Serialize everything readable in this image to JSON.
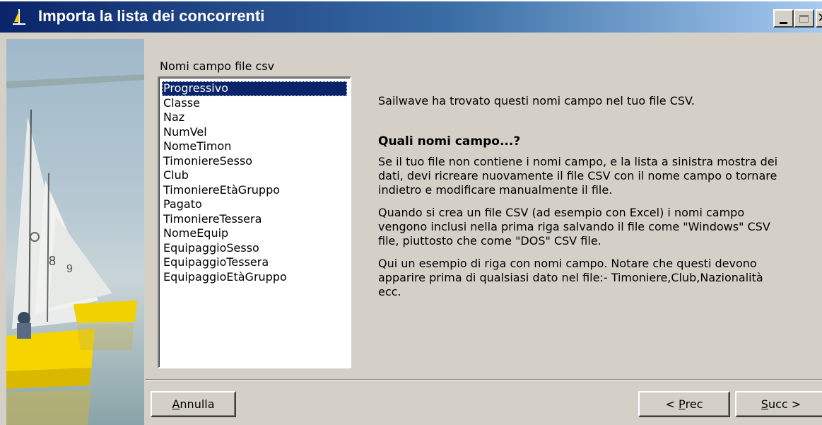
{
  "window": {
    "title": "Importa la lista dei concorrenti",
    "icon": "sailboat-app-icon"
  },
  "list": {
    "caption": "Nomi campo file csv",
    "items": [
      "Progressivo",
      "Classe",
      "Naz",
      "NumVel",
      "NomeTimon",
      "TimoniereSesso",
      "Club",
      "TimoniereEtàGruppo",
      "Pagato",
      "TimoniereTessera",
      "NomeEquip",
      "EquipaggioSesso",
      "EquipaggioTessera",
      "EquipaggioEtàGruppo"
    ],
    "selected_index": 0
  },
  "info": {
    "intro": "Sailwave ha trovato questi nomi campo nel tuo file CSV.",
    "heading": "Quali nomi campo...?",
    "para1": "Se il tuo file non contiene i nomi campo, e la lista a sinistra mostra dei dati, devi ricreare nuovamente il file CSV con il nome campo o tornare indietro e modificare manualmente il file.",
    "para2": "Quando si crea un file CSV (ad esempio con Excel) i nomi campo vengono inclusi nella prima riga salvando il file come \"Windows\" CSV file, piuttosto che come \"DOS\" CSV file.",
    "para3": "Qui un esempio di riga con nomi campo.  Notare che questi devono apparire prima di qualsiasi dato nel file:- Timoniere,Club,Nazionalità ecc."
  },
  "buttons": {
    "cancel": {
      "hotkey": "A",
      "rest": "nnulla"
    },
    "prev": {
      "prefix": "< ",
      "hotkey": "P",
      "rest": "rec"
    },
    "next": {
      "hotkey": "S",
      "rest": "ucc >"
    }
  },
  "colors": {
    "titlebar_start": "#0a246a",
    "titlebar_end": "#a6caf0",
    "selection": "#0a246a",
    "face": "#d4d0c8"
  }
}
